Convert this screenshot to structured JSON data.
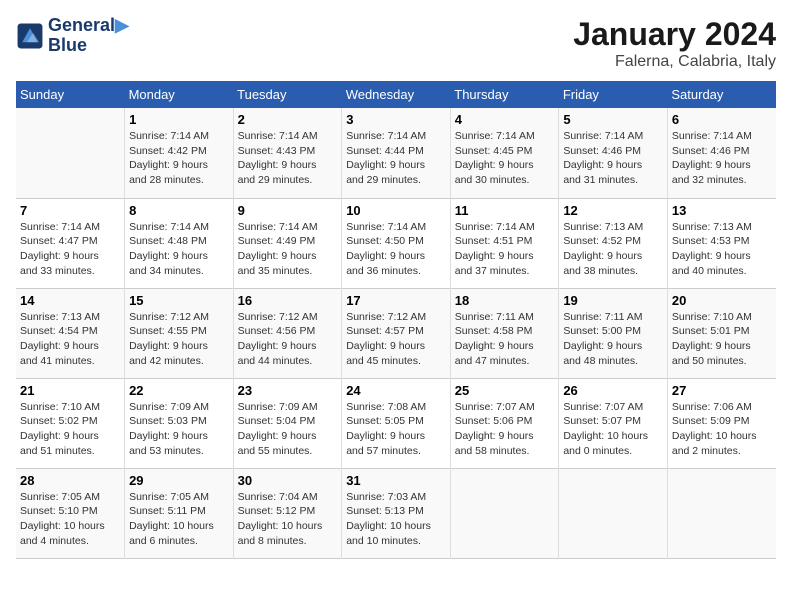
{
  "logo": {
    "line1": "General",
    "line2": "Blue"
  },
  "title": "January 2024",
  "subtitle": "Falerna, Calabria, Italy",
  "days_header": [
    "Sunday",
    "Monday",
    "Tuesday",
    "Wednesday",
    "Thursday",
    "Friday",
    "Saturday"
  ],
  "weeks": [
    [
      {
        "day": "",
        "info": ""
      },
      {
        "day": "1",
        "info": "Sunrise: 7:14 AM\nSunset: 4:42 PM\nDaylight: 9 hours\nand 28 minutes."
      },
      {
        "day": "2",
        "info": "Sunrise: 7:14 AM\nSunset: 4:43 PM\nDaylight: 9 hours\nand 29 minutes."
      },
      {
        "day": "3",
        "info": "Sunrise: 7:14 AM\nSunset: 4:44 PM\nDaylight: 9 hours\nand 29 minutes."
      },
      {
        "day": "4",
        "info": "Sunrise: 7:14 AM\nSunset: 4:45 PM\nDaylight: 9 hours\nand 30 minutes."
      },
      {
        "day": "5",
        "info": "Sunrise: 7:14 AM\nSunset: 4:46 PM\nDaylight: 9 hours\nand 31 minutes."
      },
      {
        "day": "6",
        "info": "Sunrise: 7:14 AM\nSunset: 4:46 PM\nDaylight: 9 hours\nand 32 minutes."
      }
    ],
    [
      {
        "day": "7",
        "info": ""
      },
      {
        "day": "8",
        "info": "Sunrise: 7:14 AM\nSunset: 4:48 PM\nDaylight: 9 hours\nand 34 minutes."
      },
      {
        "day": "9",
        "info": "Sunrise: 7:14 AM\nSunset: 4:49 PM\nDaylight: 9 hours\nand 35 minutes."
      },
      {
        "day": "10",
        "info": "Sunrise: 7:14 AM\nSunset: 4:50 PM\nDaylight: 9 hours\nand 36 minutes."
      },
      {
        "day": "11",
        "info": "Sunrise: 7:14 AM\nSunset: 4:51 PM\nDaylight: 9 hours\nand 37 minutes."
      },
      {
        "day": "12",
        "info": "Sunrise: 7:13 AM\nSunset: 4:52 PM\nDaylight: 9 hours\nand 38 minutes."
      },
      {
        "day": "13",
        "info": "Sunrise: 7:13 AM\nSunset: 4:53 PM\nDaylight: 9 hours\nand 40 minutes."
      }
    ],
    [
      {
        "day": "14",
        "info": ""
      },
      {
        "day": "15",
        "info": "Sunrise: 7:12 AM\nSunset: 4:55 PM\nDaylight: 9 hours\nand 42 minutes."
      },
      {
        "day": "16",
        "info": "Sunrise: 7:12 AM\nSunset: 4:56 PM\nDaylight: 9 hours\nand 44 minutes."
      },
      {
        "day": "17",
        "info": "Sunrise: 7:12 AM\nSunset: 4:57 PM\nDaylight: 9 hours\nand 45 minutes."
      },
      {
        "day": "18",
        "info": "Sunrise: 7:11 AM\nSunset: 4:58 PM\nDaylight: 9 hours\nand 47 minutes."
      },
      {
        "day": "19",
        "info": "Sunrise: 7:11 AM\nSunset: 5:00 PM\nDaylight: 9 hours\nand 48 minutes."
      },
      {
        "day": "20",
        "info": "Sunrise: 7:10 AM\nSunset: 5:01 PM\nDaylight: 9 hours\nand 50 minutes."
      }
    ],
    [
      {
        "day": "21",
        "info": "Sunrise: 7:10 AM\nSunset: 5:02 PM\nDaylight: 9 hours\nand 51 minutes."
      },
      {
        "day": "22",
        "info": "Sunrise: 7:09 AM\nSunset: 5:03 PM\nDaylight: 9 hours\nand 53 minutes."
      },
      {
        "day": "23",
        "info": "Sunrise: 7:09 AM\nSunset: 5:04 PM\nDaylight: 9 hours\nand 55 minutes."
      },
      {
        "day": "24",
        "info": "Sunrise: 7:08 AM\nSunset: 5:05 PM\nDaylight: 9 hours\nand 57 minutes."
      },
      {
        "day": "25",
        "info": "Sunrise: 7:07 AM\nSunset: 5:06 PM\nDaylight: 9 hours\nand 58 minutes."
      },
      {
        "day": "26",
        "info": "Sunrise: 7:07 AM\nSunset: 5:07 PM\nDaylight: 10 hours\nand 0 minutes."
      },
      {
        "day": "27",
        "info": "Sunrise: 7:06 AM\nSunset: 5:09 PM\nDaylight: 10 hours\nand 2 minutes."
      }
    ],
    [
      {
        "day": "28",
        "info": "Sunrise: 7:05 AM\nSunset: 5:10 PM\nDaylight: 10 hours\nand 4 minutes."
      },
      {
        "day": "29",
        "info": "Sunrise: 7:05 AM\nSunset: 5:11 PM\nDaylight: 10 hours\nand 6 minutes."
      },
      {
        "day": "30",
        "info": "Sunrise: 7:04 AM\nSunset: 5:12 PM\nDaylight: 10 hours\nand 8 minutes."
      },
      {
        "day": "31",
        "info": "Sunrise: 7:03 AM\nSunset: 5:13 PM\nDaylight: 10 hours\nand 10 minutes."
      },
      {
        "day": "",
        "info": ""
      },
      {
        "day": "",
        "info": ""
      },
      {
        "day": "",
        "info": ""
      }
    ]
  ],
  "week7_sunday": "Sunrise: 7:14 AM\nSunset: 4:47 PM\nDaylight: 9 hours\nand 33 minutes.",
  "week14_sunday": "Sunrise: 7:13 AM\nSunset: 4:54 PM\nDaylight: 9 hours\nand 41 minutes."
}
